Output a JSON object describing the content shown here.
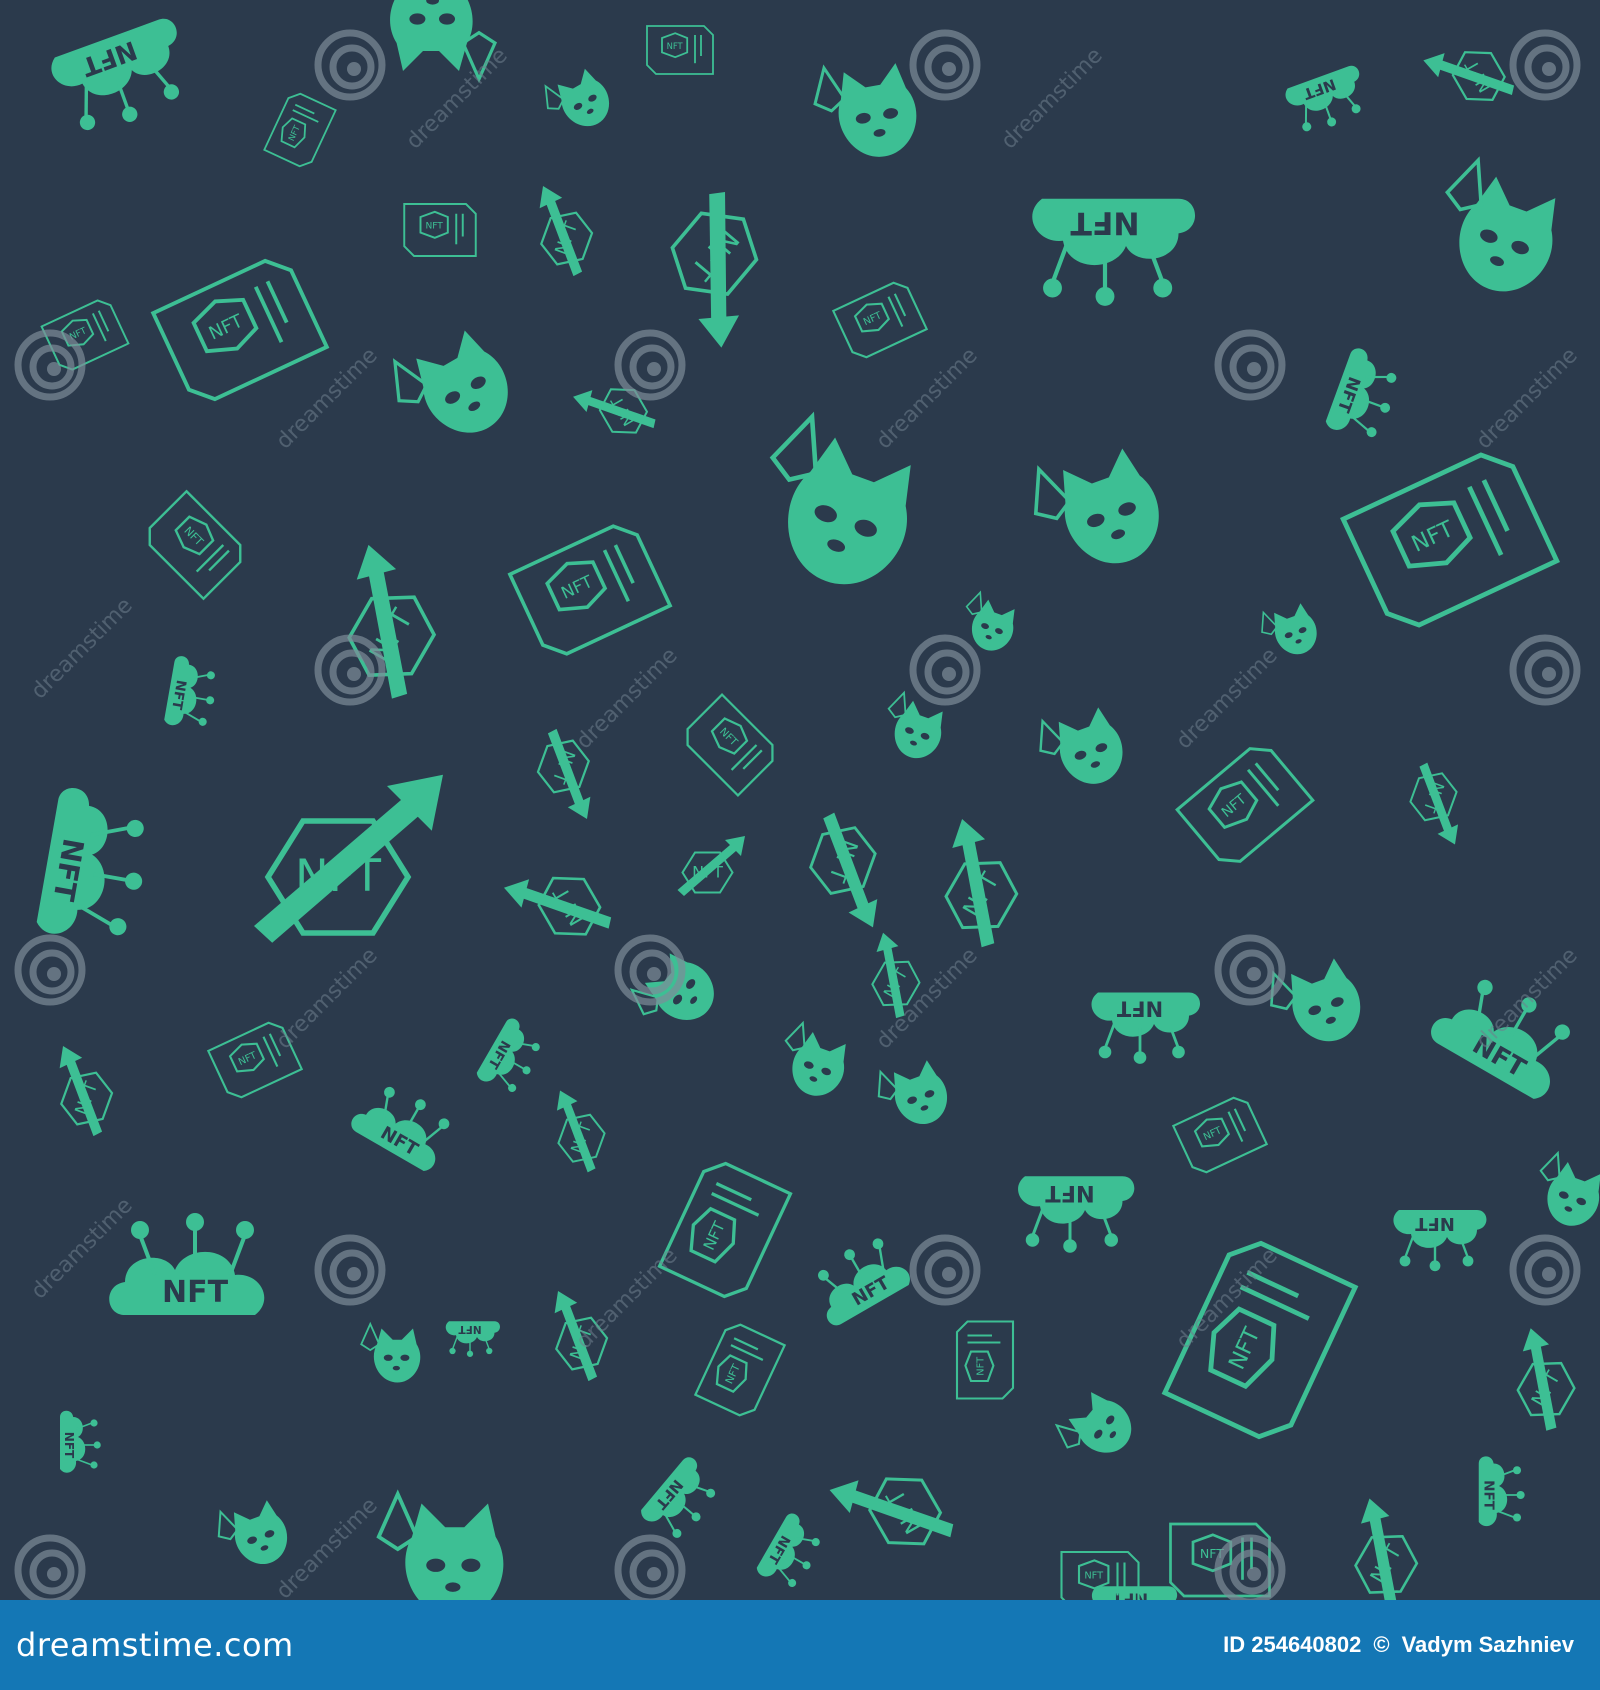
{
  "footer": {
    "brand": "dreamstime.com",
    "id_label": "ID 254640802",
    "copyright_symbol": "©",
    "author": "Vadym Sazhniev"
  },
  "pattern": {
    "background_color": "#2b3a4c",
    "icon_color": "#3dbf94",
    "watermark_text": "dreamstime",
    "icon_types": [
      "nft-cloud-icon",
      "nft-document-icon",
      "nft-growth-arrow-icon",
      "nft-cat-ethereum-icon"
    ]
  }
}
